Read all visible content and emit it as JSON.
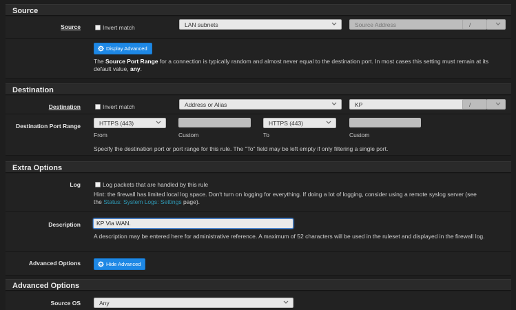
{
  "sections": {
    "source": "Source",
    "destination": "Destination",
    "extra": "Extra Options",
    "advanced": "Advanced Options"
  },
  "source": {
    "label": "Source",
    "invert_label": "Invert match",
    "type_value": "LAN subnets",
    "address_placeholder": "Source Address",
    "mask_separator": "/",
    "display_advanced_label": "Display Advanced",
    "help_pre": "The ",
    "help_bold": "Source Port Range",
    "help_mid": " for a connection is typically random and almost never equal to the destination port. In most cases this setting must remain at its default value, ",
    "help_bold2": "any",
    "help_post": "."
  },
  "destination": {
    "label": "Destination",
    "invert_label": "Invert match",
    "type_value": "Address or Alias",
    "address_value": "KP",
    "mask_separator": "/",
    "port_range_label": "Destination Port Range",
    "from_value": "HTTPS (443)",
    "to_value": "HTTPS (443)",
    "from_label": "From",
    "custom_label_1": "Custom",
    "to_label": "To",
    "custom_label_2": "Custom",
    "help": "Specify the destination port or port range for this rule. The \"To\" field may be left empty if only filtering a single port."
  },
  "extra": {
    "log_label": "Log",
    "log_checkbox_label": "Log packets that are handled by this rule",
    "log_hint_1": "Hint: the firewall has limited local log space. Don't turn on logging for everything. If doing a lot of logging, consider using a remote syslog server (see",
    "log_hint_2_pre": "the ",
    "log_hint_link": "Status: System Logs: Settings",
    "log_hint_2_post": " page).",
    "description_label": "Description",
    "description_value": "KP Via WAN.",
    "description_help": "A description may be entered here for administrative reference. A maximum of 52 characters will be used in the ruleset and displayed in the firewall log.",
    "advanced_options_label": "Advanced Options",
    "hide_advanced_label": "Hide Advanced"
  },
  "advanced": {
    "source_os_label": "Source OS",
    "source_os_value": "Any"
  },
  "colors": {
    "background": "#1e1e1e",
    "button": "#1e88e5",
    "link": "#2f9bb7"
  }
}
